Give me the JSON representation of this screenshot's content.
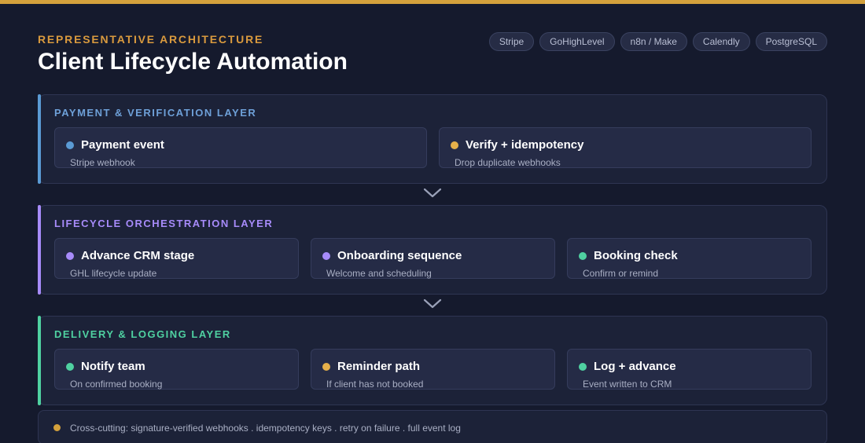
{
  "header": {
    "eyebrow": "REPRESENTATIVE ARCHITECTURE",
    "title": "Client Lifecycle Automation"
  },
  "tech_chips": [
    "Stripe",
    "GoHighLevel",
    "n8n / Make",
    "Calendly",
    "PostgreSQL"
  ],
  "colors": {
    "top_bar": "#d4a13c",
    "blue": "#5b9bd5",
    "purple": "#a78bfa",
    "green": "#4fd1a1",
    "gold": "#e6b04a"
  },
  "layers": [
    {
      "title": "PAYMENT & VERIFICATION LAYER",
      "color": "#6ea0d8",
      "cards": [
        {
          "title": "Payment event",
          "subtitle": "Stripe webhook",
          "dot": "#5b9bd5"
        },
        {
          "title": "Verify + idempotency",
          "subtitle": "Drop duplicate webhooks",
          "dot": "#e6b04a"
        }
      ]
    },
    {
      "title": "LIFECYCLE ORCHESTRATION LAYER",
      "color": "#a78bfa",
      "cards": [
        {
          "title": "Advance CRM stage",
          "subtitle": "GHL lifecycle update",
          "dot": "#a78bfa"
        },
        {
          "title": "Onboarding sequence",
          "subtitle": "Welcome and scheduling",
          "dot": "#a78bfa"
        },
        {
          "title": "Booking check",
          "subtitle": "Confirm or remind",
          "dot": "#4fd1a1"
        }
      ]
    },
    {
      "title": "DELIVERY & LOGGING LAYER",
      "color": "#4fd1a1",
      "cards": [
        {
          "title": "Notify team",
          "subtitle": "On confirmed booking",
          "dot": "#4fd1a1"
        },
        {
          "title": "Reminder path",
          "subtitle": "If client has not booked",
          "dot": "#e6b04a"
        },
        {
          "title": "Log + advance",
          "subtitle": "Event written to CRM",
          "dot": "#4fd1a1"
        }
      ]
    }
  ],
  "footer": {
    "text": "Cross-cutting: signature-verified webhooks . idempotency keys . retry on failure . full event log"
  }
}
